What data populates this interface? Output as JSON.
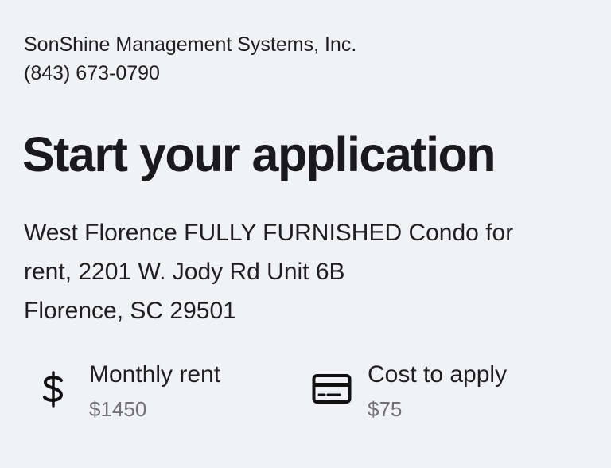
{
  "company": {
    "name": "SonShine Management Systems, Inc.",
    "phone": "(843) 673-0790"
  },
  "page_title": "Start your application",
  "property": {
    "address_line1": "West Florence FULLY FURNISHED Condo for",
    "address_line2": "rent, 2201 W. Jody Rd Unit 6B",
    "address_line3": "Florence, SC 29501"
  },
  "details": {
    "rent": {
      "icon": "dollar-icon",
      "label": "Monthly rent",
      "value": "$1450"
    },
    "apply_cost": {
      "icon": "credit-card-icon",
      "label": "Cost to apply",
      "value": "$75"
    }
  },
  "colors": {
    "background": "#f1f2f6",
    "text": "#1f1f21",
    "muted": "#707076"
  }
}
